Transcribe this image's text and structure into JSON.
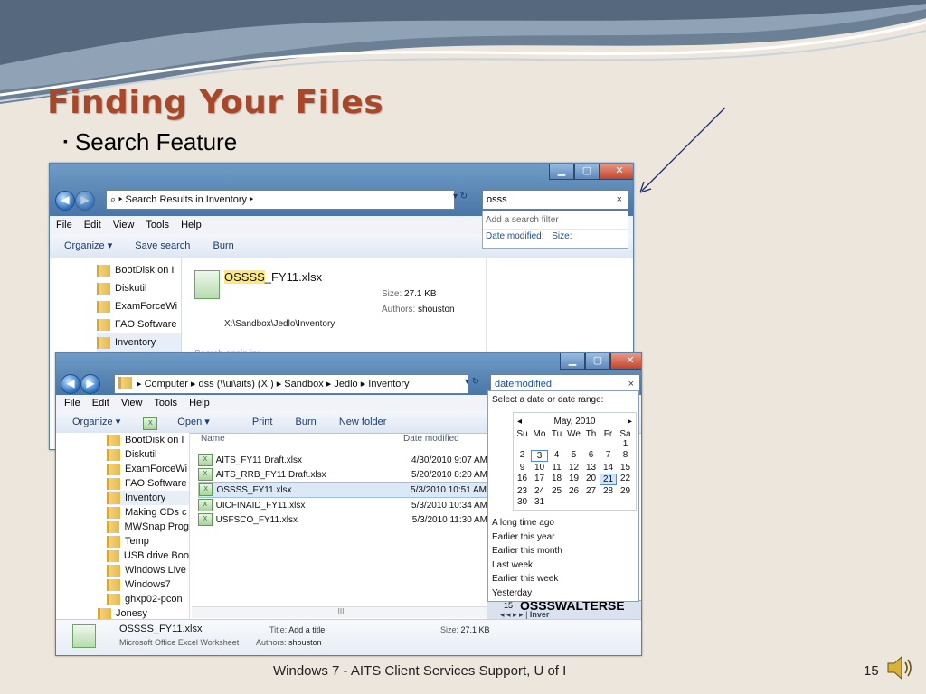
{
  "slide": {
    "title": "Finding Your Files",
    "bullet": "Search Feature",
    "footer": "Windows 7 - AITS Client Services Support, U of I",
    "page_number": "15"
  },
  "window1": {
    "address_parts": [
      "Search Results in Inventory"
    ],
    "search_value": "osss",
    "search_close": "×",
    "search_filter_title": "Add a search filter",
    "filter_date": "Date modified:",
    "filter_size": "Size:",
    "menu": [
      "File",
      "Edit",
      "View",
      "Tools",
      "Help"
    ],
    "commands": [
      "Organize ▾",
      "Save search",
      "Burn"
    ],
    "tree": [
      "BootDisk on I",
      "Diskutil",
      "ExamForceWi",
      "FAO Software",
      "Inventory"
    ],
    "result": {
      "name_highlight": "OSSSS",
      "name_rest": "_FY11.xlsx",
      "path": "X:\\Sandbox\\Jedlo\\Inventory",
      "size_label": "Size:",
      "size_value": "27.1 KB",
      "authors_label": "Authors:",
      "authors_value": "shouston"
    },
    "search_again": "Search again in:"
  },
  "window2": {
    "address_parts": [
      "Computer",
      "dss (\\\\ui\\aits) (X:)",
      "Sandbox",
      "Jedlo",
      "Inventory"
    ],
    "search_value": "datemodified:",
    "search_close": "×",
    "menu": [
      "File",
      "Edit",
      "View",
      "Tools",
      "Help"
    ],
    "commands": [
      "Organize ▾",
      "Open ▾",
      "Print",
      "Burn",
      "New folder"
    ],
    "tree": [
      "BootDisk on I",
      "Diskutil",
      "ExamForceWi",
      "FAO Software",
      "Inventory",
      "Making CDs c",
      "MWSnap Prog",
      "Temp",
      "USB drive Boo",
      "Windows Live",
      "Windows7",
      "ghxp02-pcon",
      "Jonesy"
    ],
    "columns": [
      "Name",
      "Date modified"
    ],
    "files": [
      {
        "name": "AITS_FY11 Draft.xlsx",
        "date": "4/30/2010 9:07 AM"
      },
      {
        "name": "AITS_RRB_FY11 Draft.xlsx",
        "date": "5/20/2010 8:20 AM"
      },
      {
        "name": "OSSSS_FY11.xlsx",
        "date": "5/3/2010 10:51 AM"
      },
      {
        "name": "UICFINAID_FY11.xlsx",
        "date": "5/3/2010 10:34 AM"
      },
      {
        "name": "USFSCO_FY11.xlsx",
        "date": "5/3/2010 11:30 AM"
      }
    ],
    "selected_file_index": 2,
    "calendar": {
      "prompt": "Select a date or date range:",
      "month": "May, 2010",
      "prev": "◂",
      "next": "▸",
      "weekdays": [
        "Su",
        "Mo",
        "Tu",
        "We",
        "Th",
        "Fr",
        "Sa"
      ],
      "days": [
        "",
        "",
        "",
        "",
        "",
        "",
        "1",
        "2",
        "3",
        "4",
        "5",
        "6",
        "7",
        "8",
        "9",
        "10",
        "11",
        "12",
        "13",
        "14",
        "15",
        "16",
        "17",
        "18",
        "19",
        "20",
        "21",
        "22",
        "23",
        "24",
        "25",
        "26",
        "27",
        "28",
        "29",
        "30",
        "31"
      ],
      "today": "3",
      "selected": "21",
      "ranges": [
        "A long time ago",
        "Earlier this year",
        "Earlier this month",
        "Last week",
        "Earlier this week",
        "Yesterday"
      ]
    },
    "behind_text": "OSSSWALTERSE",
    "behind_num": "15",
    "behind_tab": "Inver",
    "details": {
      "name": "OSSSS_FY11.xlsx",
      "type": "Microsoft Office Excel Worksheet",
      "title_label": "Title:",
      "title_value": "Add a title",
      "authors_label": "Authors:",
      "authors_value": "shouston",
      "size_label": "Size:",
      "size_value": "27.1 KB"
    },
    "scroll_mid": "III"
  }
}
